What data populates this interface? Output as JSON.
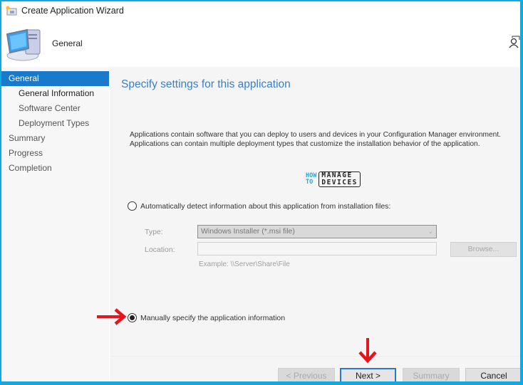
{
  "window": {
    "title": "Create Application Wizard",
    "title_icon": "wizard-icon"
  },
  "header": {
    "title": "General",
    "icon": "computer-icon",
    "user_icon": "user-icon"
  },
  "sidebar": {
    "items": [
      {
        "label": "General",
        "level": 0,
        "state": "active"
      },
      {
        "label": "General Information",
        "level": 1,
        "state": "current"
      },
      {
        "label": "Software Center",
        "level": 1,
        "state": "normal"
      },
      {
        "label": "Deployment Types",
        "level": 1,
        "state": "normal"
      },
      {
        "label": "Summary",
        "level": 0,
        "state": "normal"
      },
      {
        "label": "Progress",
        "level": 0,
        "state": "normal"
      },
      {
        "label": "Completion",
        "level": 0,
        "state": "normal"
      }
    ]
  },
  "main": {
    "page_title": "Specify settings for this application",
    "description_line1": "Applications contain software that you can deploy to users and devices in your Configuration Manager environment.",
    "description_line2": "Applications can contain multiple deployment types that customize the installation behavior of the application.",
    "logo": {
      "how": "HOW",
      "to": "TO",
      "manage": "MANAGE",
      "devices": "DEVICES"
    },
    "option_auto": {
      "label": "Automatically detect information about this application from installation files:",
      "selected": false
    },
    "type_label": "Type:",
    "type_value": "Windows Installer (*.msi file)",
    "location_label": "Location:",
    "location_value": "",
    "example_text": "Example: \\\\Server\\Share\\File",
    "browse_label": "Browse...",
    "option_manual": {
      "label": "Manually specify the application information",
      "selected": true
    }
  },
  "buttons": {
    "previous": "< Previous",
    "next": "Next >",
    "summary": "Summary",
    "cancel": "Cancel"
  },
  "annotations": {
    "arrow_color": "#e8141b"
  }
}
